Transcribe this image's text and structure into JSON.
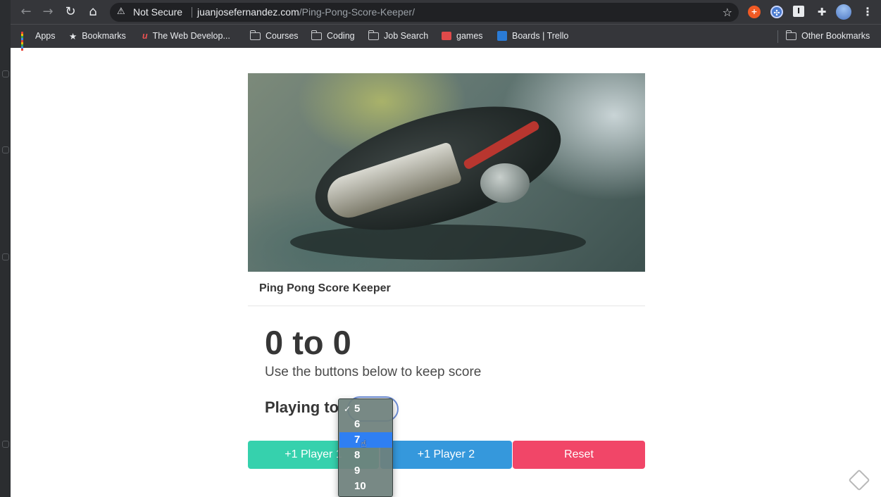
{
  "browser": {
    "security_label": "Not Secure",
    "url_host": "juanjosefernandez.com",
    "url_path": "/Ping-Pong-Score-Keeper/",
    "nav_back": "←",
    "nav_forward": "→",
    "nav_reload": "↻",
    "nav_home": "⌂"
  },
  "bookmarks": [
    {
      "label": "Apps",
      "icon": "apps-grid-icon"
    },
    {
      "label": "Bookmarks",
      "icon": "star-icon"
    },
    {
      "label": "The Web Develop...",
      "icon": "udemy-icon"
    },
    {
      "label": "Courses",
      "icon": "folder-icon"
    },
    {
      "label": "Coding",
      "icon": "folder-icon"
    },
    {
      "label": "Job Search",
      "icon": "folder-icon"
    },
    {
      "label": "games",
      "icon": "store-icon"
    },
    {
      "label": "Boards | Trello",
      "icon": "trello-icon"
    },
    {
      "label": "Other Bookmarks",
      "icon": "folder-icon"
    }
  ],
  "page": {
    "card_title": "Ping Pong Score Keeper",
    "score_text": "0 to 0",
    "subtitle": "Use the buttons below to keep score",
    "playing_to_label": "Playing to",
    "buttons": {
      "player1": "+1 Player 1",
      "player2": "+1 Player 2",
      "reset": "Reset"
    }
  },
  "dropdown": {
    "options": [
      "5",
      "6",
      "7",
      "8",
      "9",
      "10"
    ],
    "checked_value": "5",
    "highlighted_value": "7"
  },
  "colors": {
    "player1": "#36d1ad",
    "player2": "#3598dc",
    "reset": "#f14668",
    "highlight": "#2f7ff2"
  }
}
